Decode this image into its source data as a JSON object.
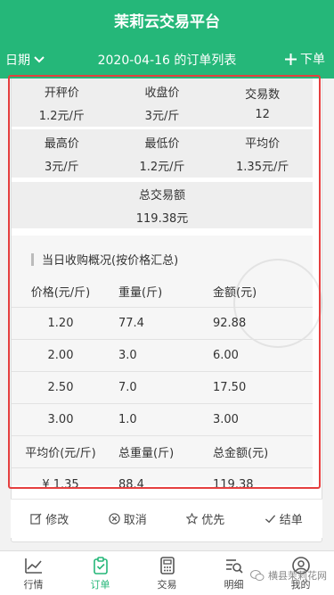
{
  "app": {
    "title": "茉莉云交易平台"
  },
  "subbar": {
    "date_label": "日期",
    "list_title": "2020-04-16 的订单列表",
    "order_label": "下单"
  },
  "stats": {
    "row1": [
      {
        "label": "开秤价",
        "value": "1.2元/斤"
      },
      {
        "label": "收盘价",
        "value": "3元/斤"
      },
      {
        "label": "交易数",
        "value": "12"
      }
    ],
    "row2": [
      {
        "label": "最高价",
        "value": "3元/斤"
      },
      {
        "label": "最低价",
        "value": "1.2元/斤"
      },
      {
        "label": "平均价",
        "value": "1.35元/斤"
      }
    ],
    "total": {
      "label": "总交易额",
      "value": "119.38元"
    }
  },
  "summary": {
    "title": "当日收购概况(按价格汇总)",
    "headers": [
      "价格(元/斤)",
      "重量(斤)",
      "金额(元)"
    ],
    "rows": [
      [
        "1.20",
        "77.4",
        "92.88"
      ],
      [
        "2.00",
        "3.0",
        "6.00"
      ],
      [
        "2.50",
        "7.0",
        "17.50"
      ],
      [
        "3.00",
        "1.0",
        "3.00"
      ]
    ],
    "footer_headers": [
      "平均价(元/斤)",
      "总重量(斤)",
      "总金额(元)"
    ],
    "footer_values": [
      "¥ 1.35",
      "88.4",
      "119.38"
    ]
  },
  "actions": {
    "edit": "修改",
    "cancel": "取消",
    "priority": "优先",
    "settle": "结单"
  },
  "tabs": [
    {
      "label": "行情",
      "icon": "chart-icon"
    },
    {
      "label": "订单",
      "icon": "clipboard-icon"
    },
    {
      "label": "交易",
      "icon": "calculator-icon"
    },
    {
      "label": "明细",
      "icon": "search-list-icon"
    },
    {
      "label": "我的",
      "icon": "user-icon"
    }
  ],
  "watermark": "横县茉莉花网",
  "colors": {
    "brand": "#25b779",
    "highlight": "#e53f3f"
  }
}
